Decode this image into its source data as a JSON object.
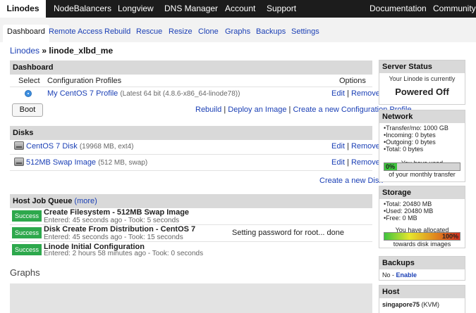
{
  "nav": {
    "linodes": "Linodes",
    "nodebalancers": "NodeBalancers",
    "longview": "Longview",
    "dns": "DNS Manager",
    "account": "Account",
    "support": "Support",
    "documentation": "Documentation",
    "community": "Community"
  },
  "tabs": {
    "dashboard": "Dashboard",
    "remote": "Remote Access",
    "rebuild": "Rebuild",
    "rescue": "Rescue",
    "resize": "Resize",
    "clone": "Clone",
    "graphs": "Graphs",
    "backups": "Backups",
    "settings": "Settings"
  },
  "breadcrumb": {
    "parent": "Linodes",
    "sep": "»",
    "current": "linode_xlbd_me"
  },
  "dashboard": {
    "title": "Dashboard",
    "col_select": "Select",
    "col_profiles": "Configuration Profiles",
    "col_options": "Options",
    "profile_name": "My CentOS 7 Profile",
    "profile_detail": "(Latest 64 bit (4.8.6-x86_64-linode78))",
    "edit": "Edit",
    "sep": "|",
    "remove": "Remove",
    "boot": "Boot",
    "rebuild": "Rebuild",
    "deploy": "Deploy an Image",
    "create_profile": "Create a new Configuration Profile"
  },
  "disks": {
    "title": "Disks",
    "items": [
      {
        "name": "CentOS 7 Disk",
        "detail": "(19968 MB, ext4)"
      },
      {
        "name": "512MB Swap Image",
        "detail": "(512 MB, swap)"
      }
    ],
    "edit": "Edit",
    "sep": "|",
    "remove": "Remove",
    "create": "Create a new Disk"
  },
  "jobs": {
    "title": "Host Job Queue",
    "more": "(more)",
    "items": [
      {
        "status": "Success",
        "title": "Create Filesystem - 512MB Swap Image",
        "meta": "Entered: 45 seconds ago - Took: 5 seconds",
        "note": ""
      },
      {
        "status": "Success",
        "title": "Disk Create From Distribution - CentOS 7",
        "meta": "Entered: 45 seconds ago - Took: 15 seconds",
        "note": "Setting password for root... done"
      },
      {
        "status": "Success",
        "title": "Linode Initial Configuration",
        "meta": "Entered: 2 hours 58 minutes ago - Took: 0 seconds",
        "note": ""
      }
    ]
  },
  "graphs": {
    "title": "Graphs"
  },
  "server_status": {
    "title": "Server Status",
    "line": "Your Linode is currently",
    "state": "Powered Off"
  },
  "network": {
    "title": "Network",
    "items": [
      "Transfer/mo: 1000 GB",
      "Incoming: 0 bytes",
      "Outgoing: 0 bytes",
      "Total: 0 bytes"
    ],
    "used_label": "You have used",
    "percent": "0%",
    "percent_value": 0,
    "suffix": "of your monthly transfer"
  },
  "storage": {
    "title": "Storage",
    "items": [
      "Total: 20480 MB",
      "Used: 20480 MB",
      "Free: 0 MB"
    ],
    "allocated_label": "You have allocated",
    "percent": "100%",
    "percent_value": 100,
    "suffix": "towards disk images"
  },
  "backups": {
    "title": "Backups",
    "state": "No -",
    "enable": "Enable"
  },
  "host": {
    "title": "Host",
    "name": "singapore75",
    "type": "(KVM)"
  },
  "colors": {
    "success": "#2da84c",
    "nav_bg": "#1c1c1c",
    "link": "#1a3fb5"
  }
}
